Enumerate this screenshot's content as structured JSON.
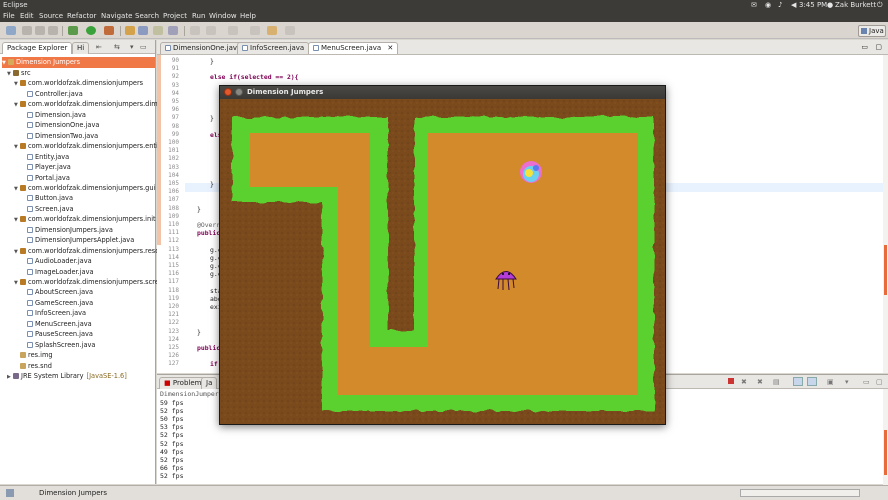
{
  "system": {
    "app_name": "Eclipse",
    "clock": "3:45 PM",
    "user": "Zak Burkett"
  },
  "menu": [
    "File",
    "Edit",
    "Source",
    "Refactor",
    "Navigate",
    "Search",
    "Project",
    "Run",
    "Window",
    "Help"
  ],
  "perspective": {
    "label": "Java"
  },
  "package_explorer": {
    "tab": "Package Explorer",
    "tab2": "Hi",
    "project": "Dimension Jumpers",
    "items": [
      {
        "label": "src",
        "indent": 1
      },
      {
        "label": "com.worldofzak.dimensionjumpers",
        "indent": 2,
        "type": "pkg"
      },
      {
        "label": "Controller.java",
        "indent": 3,
        "type": "java"
      },
      {
        "label": "com.worldofzak.dimensionjumpers.dim",
        "indent": 2,
        "type": "pkg"
      },
      {
        "label": "Dimension.java",
        "indent": 3,
        "type": "java"
      },
      {
        "label": "DimensionOne.java",
        "indent": 3,
        "type": "java"
      },
      {
        "label": "DimensionTwo.java",
        "indent": 3,
        "type": "java"
      },
      {
        "label": "com.worldofzak.dimensionjumpers.enti",
        "indent": 2,
        "type": "pkg"
      },
      {
        "label": "Entity.java",
        "indent": 3,
        "type": "java"
      },
      {
        "label": "Player.java",
        "indent": 3,
        "type": "java"
      },
      {
        "label": "Portal.java",
        "indent": 3,
        "type": "java"
      },
      {
        "label": "com.worldofzak.dimensionjumpers.gui",
        "indent": 2,
        "type": "pkg"
      },
      {
        "label": "Button.java",
        "indent": 3,
        "type": "java"
      },
      {
        "label": "Screen.java",
        "indent": 3,
        "type": "java"
      },
      {
        "label": "com.worldofzak.dimensionjumpers.init",
        "indent": 2,
        "type": "pkg"
      },
      {
        "label": "DimensionJumpers.java",
        "indent": 3,
        "type": "java"
      },
      {
        "label": "DimensionJumpersApplet.java",
        "indent": 3,
        "type": "java"
      },
      {
        "label": "com.worldofzak.dimensionjumpers.reso",
        "indent": 2,
        "type": "pkg"
      },
      {
        "label": "AudioLoader.java",
        "indent": 3,
        "type": "java"
      },
      {
        "label": "ImageLoader.java",
        "indent": 3,
        "type": "java"
      },
      {
        "label": "com.worldofzak.dimensionjumpers.scre",
        "indent": 2,
        "type": "pkg"
      },
      {
        "label": "AboutScreen.java",
        "indent": 3,
        "type": "java"
      },
      {
        "label": "GameScreen.java",
        "indent": 3,
        "type": "java"
      },
      {
        "label": "InfoScreen.java",
        "indent": 3,
        "type": "java"
      },
      {
        "label": "MenuScreen.java",
        "indent": 3,
        "type": "java"
      },
      {
        "label": "PauseScreen.java",
        "indent": 3,
        "type": "java"
      },
      {
        "label": "SplashScreen.java",
        "indent": 3,
        "type": "java"
      },
      {
        "label": "res.img",
        "indent": 2,
        "type": "folder"
      },
      {
        "label": "res.snd",
        "indent": 2,
        "type": "folder"
      },
      {
        "label": "JRE System Library",
        "indent": 1,
        "type": "lib",
        "suffix": "[JavaSE-1.6]"
      }
    ]
  },
  "editor": {
    "tabs": [
      "DimensionOne.java",
      "InfoScreen.java",
      "MenuScreen.java"
    ],
    "active_tab": "MenuScreen.java",
    "line_numbers": [
      "90",
      "91",
      "92",
      "93",
      "94",
      "95",
      "96",
      "97",
      "98",
      "99",
      "100",
      "101",
      "102",
      "103",
      "104",
      "105",
      "106",
      "107",
      "108",
      "109",
      "110",
      "111",
      "112",
      "113",
      "114",
      "115",
      "116",
      "117",
      "118",
      "119",
      "120",
      "121",
      "122",
      "123",
      "124",
      "125",
      "126",
      "127"
    ],
    "code": {
      "l90": "}",
      "l92": "else if(selected == 2){",
      "l97": "}",
      "l99": "else",
      "l105": "}",
      "l108": "}",
      "l110": "@Override",
      "l111": "public",
      "l113": "g.c",
      "l114": "g.c",
      "l115": "g.c",
      "l116": "g.c",
      "l118": "sta",
      "l119": "abo",
      "l120": "exi",
      "l123": "}",
      "l125": "public",
      "l127": "if("
    },
    "tail_line": "if("
  },
  "console": {
    "tabs": [
      "Problems",
      "Ja"
    ],
    "process": "DimensionJumpers",
    "lines": [
      "59 fps",
      "52 fps",
      "50 fps",
      "53 fps",
      "52 fps",
      "52 fps",
      "49 fps",
      "52 fps",
      "66 fps",
      "52 fps"
    ]
  },
  "game_window": {
    "title": "Dimension Jumpers"
  },
  "status_bar": {
    "text": "Dimension Jumpers"
  },
  "colors": {
    "grass": "#5ad12e",
    "dirt": "#d28a2a",
    "soil": "#7a4a1c",
    "title_bar": "#3c3b37",
    "close_button": "#e0582c"
  }
}
